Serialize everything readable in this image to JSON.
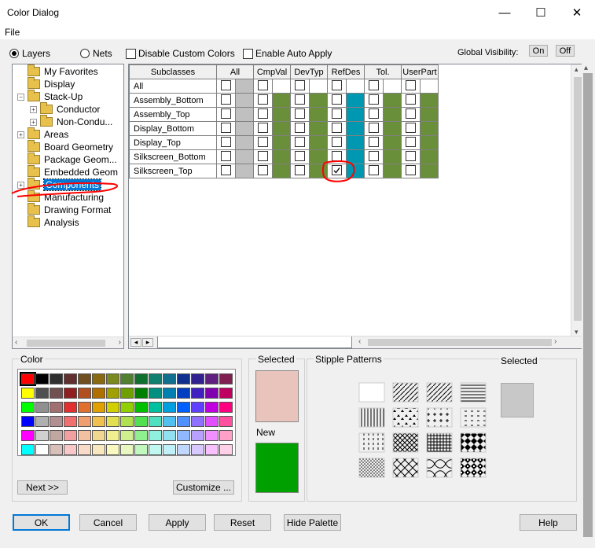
{
  "window": {
    "title": "Color Dialog",
    "min": "—",
    "max": "☐",
    "close": "✕"
  },
  "menu": {
    "file": "File"
  },
  "top": {
    "layers": "Layers",
    "nets": "Nets",
    "disable_custom": "Disable Custom Colors",
    "enable_auto": "Enable Auto Apply",
    "global_visibility": "Global Visibility:",
    "on": "On",
    "off": "Off"
  },
  "tree": [
    {
      "label": "My Favorites",
      "indent": 0,
      "exp": ""
    },
    {
      "label": "Display",
      "indent": 0,
      "exp": ""
    },
    {
      "label": "Stack-Up",
      "indent": 0,
      "exp": "−"
    },
    {
      "label": "Conductor",
      "indent": 1,
      "exp": "+"
    },
    {
      "label": "Non-Condu...",
      "indent": 1,
      "exp": "+"
    },
    {
      "label": "Areas",
      "indent": 0,
      "exp": "+"
    },
    {
      "label": "Board Geometry",
      "indent": 0,
      "exp": ""
    },
    {
      "label": "Package Geom...",
      "indent": 0,
      "exp": ""
    },
    {
      "label": "Embedded Geom",
      "indent": 0,
      "exp": ""
    },
    {
      "label": "Components",
      "indent": 0,
      "exp": "+",
      "selected": true
    },
    {
      "label": "Manufacturing",
      "indent": 0,
      "exp": ""
    },
    {
      "label": "Drawing Format",
      "indent": 0,
      "exp": ""
    },
    {
      "label": "Analysis",
      "indent": 0,
      "exp": ""
    }
  ],
  "grid": {
    "headers": [
      "Subclasses",
      "All",
      "CmpVal",
      "DevTyp",
      "RefDes",
      "Tol.",
      "UserPart"
    ],
    "rows": [
      "All",
      "Assembly_Bottom",
      "Assembly_Top",
      "Display_Bottom",
      "Display_Top",
      "Silkscreen_Bottom",
      "Silkscreen_Top"
    ],
    "col_colors": [
      "#c0c0c0",
      "#6a8f3a",
      "#6a8f3a",
      "#0098b0",
      "#6a8f3a",
      "#6a8f3a"
    ],
    "checked": {
      "row": 6,
      "col": 3
    }
  },
  "color_panel": {
    "label": "Color",
    "next": "Next >>",
    "customize": "Customize ..."
  },
  "palette": [
    [
      "#ff0000",
      "#000000",
      "#303030",
      "#603030",
      "#705020",
      "#8a6a10",
      "#7a8a20",
      "#508030",
      "#107030",
      "#108070",
      "#107090",
      "#103090",
      "#302090",
      "#602080",
      "#802050"
    ],
    [
      "#ffff00",
      "#505050",
      "#705050",
      "#902020",
      "#b05020",
      "#b07000",
      "#a0a000",
      "#70a000",
      "#008000",
      "#009080",
      "#0080b0",
      "#0040c0",
      "#4020c0",
      "#8000b0",
      "#c00060"
    ],
    [
      "#00ff00",
      "#909090",
      "#a07070",
      "#e03030",
      "#e07030",
      "#e0a000",
      "#d0d000",
      "#90d000",
      "#00c000",
      "#00c0a0",
      "#00a0e0",
      "#0060ff",
      "#6040ff",
      "#c000e0",
      "#ff0080"
    ],
    [
      "#0000ff",
      "#b0b0b0",
      "#b09090",
      "#f07070",
      "#f0a070",
      "#f0c050",
      "#e0e050",
      "#b0e050",
      "#50e050",
      "#50e0c0",
      "#50c0f0",
      "#5090ff",
      "#9070ff",
      "#e050ff",
      "#ff50a0"
    ],
    [
      "#ff00ff",
      "#d0d0d0",
      "#c0a8a0",
      "#f0a0a0",
      "#f0c0a0",
      "#f0d890",
      "#f0f090",
      "#d0f090",
      "#90f090",
      "#90f0e0",
      "#90e0f0",
      "#90b8ff",
      "#b8a0ff",
      "#f090ff",
      "#ffa0c8"
    ],
    [
      "#00ffff",
      "#ffffff",
      "#d8c0b8",
      "#f8c8c8",
      "#f8dcc8",
      "#f8e8c0",
      "#f8f8c0",
      "#e8f8c0",
      "#c0f8c0",
      "#c0f8f0",
      "#c0f0f8",
      "#c0d8ff",
      "#d8c8ff",
      "#f8c0ff",
      "#ffd0e8"
    ]
  ],
  "selected": {
    "label": "Selected",
    "color": "#e8c4bc"
  },
  "new": {
    "label": "New",
    "color": "#00a000"
  },
  "stipple": {
    "label": "Stipple Patterns",
    "selected_label": "Selected",
    "selected_color": "#c8c8c8"
  },
  "buttons": {
    "ok": "OK",
    "cancel": "Cancel",
    "apply": "Apply",
    "reset": "Reset",
    "hide": "Hide Palette",
    "help": "Help"
  }
}
